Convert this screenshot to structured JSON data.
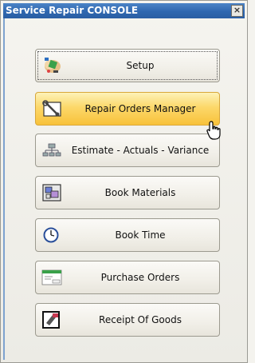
{
  "window": {
    "title": "Service Repair CONSOLE",
    "close_glyph": "×"
  },
  "menu": {
    "items": [
      {
        "name": "setup",
        "label": "Setup",
        "icon": "setup-icon"
      },
      {
        "name": "repair-orders-manager",
        "label": "Repair Orders Manager",
        "icon": "wrench-icon"
      },
      {
        "name": "estimate-actuals-variance",
        "label": "Estimate - Actuals - Variance",
        "icon": "hierarchy-icon"
      },
      {
        "name": "book-materials",
        "label": "Book Materials",
        "icon": "materials-icon"
      },
      {
        "name": "book-time",
        "label": "Book Time",
        "icon": "clock-icon"
      },
      {
        "name": "purchase-orders",
        "label": "Purchase Orders",
        "icon": "purchase-order-icon"
      },
      {
        "name": "receipt-of-goods",
        "label": "Receipt Of Goods",
        "icon": "receipt-icon"
      }
    ]
  },
  "colors": {
    "titlebar": "#2f67b0",
    "active_button": "#fcd86a",
    "button_border": "#9c9a8f"
  }
}
